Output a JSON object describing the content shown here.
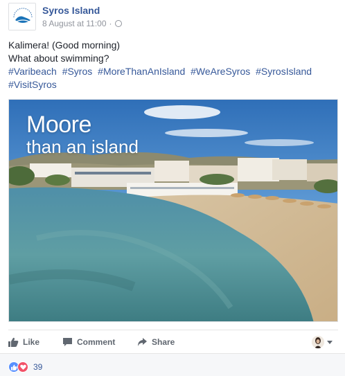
{
  "post": {
    "page_name": "Syros Island",
    "timestamp": "8 August at 11:00",
    "avatar_logo_text": "SYROS · HERMOUPOLIS",
    "text_lines": [
      "Kalimera! (Good morning)",
      "What about swimming?"
    ],
    "hashtag_lines": [
      [
        "#Varibeach",
        "#Syros",
        "#MoreThanAnIsland",
        "#WeAreSyros",
        "#SyrosIsland"
      ],
      [
        "#VisitSyros"
      ]
    ],
    "image": {
      "caption_line1": "Moore",
      "caption_line2": "than an island"
    }
  },
  "actions": {
    "like_label": "Like",
    "comment_label": "Comment",
    "share_label": "Share"
  },
  "reactions": {
    "count": "39",
    "types": [
      "like-icon",
      "love-icon"
    ]
  },
  "colors": {
    "link": "#365899",
    "text": "#1d2129",
    "meta": "#90949c",
    "action": "#606770",
    "like_blue": "#5890ff",
    "love_red": "#f25268"
  }
}
